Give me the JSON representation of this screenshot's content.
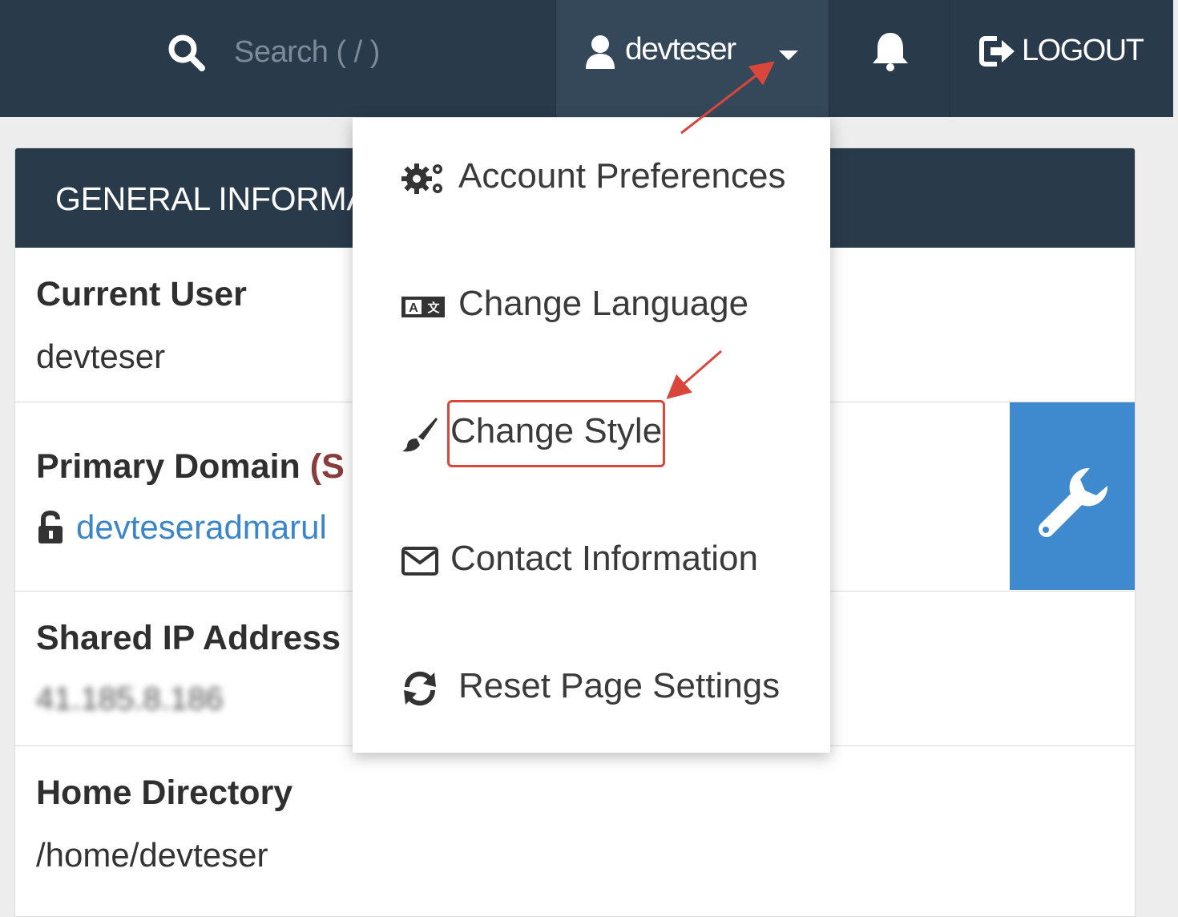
{
  "topbar": {
    "search_placeholder": "Search ( / )",
    "search_icon": "search-icon",
    "username": "devteser",
    "user_icon": "user-icon",
    "caret_icon": "caret-down-icon",
    "bell_icon": "bell-icon",
    "logout_label": "LOGOUT",
    "logout_icon": "sign-out-icon"
  },
  "panel": {
    "title": "GENERAL INFORMATION",
    "rows": [
      {
        "label": "Current User",
        "value": "devteser"
      },
      {
        "label": "Primary Domain",
        "label_suffix": "(S",
        "value": "devteseradmarul"
      },
      {
        "label": "Shared IP Address",
        "value": "41.185.8.186"
      },
      {
        "label": "Home Directory",
        "value": "/home/devteser"
      }
    ],
    "wrench_icon": "wrench-icon"
  },
  "dropdown": {
    "items": [
      {
        "label": "Account Preferences",
        "icon": "gears-icon"
      },
      {
        "label": "Change Language",
        "icon": "language-icon"
      },
      {
        "label": "Change Style",
        "icon": "paintbrush-icon",
        "highlighted": true
      },
      {
        "label": "Contact Information",
        "icon": "envelope-icon"
      },
      {
        "label": "Reset Page Settings",
        "icon": "refresh-icon"
      }
    ]
  },
  "colors": {
    "topbar_bg": "#293a4a",
    "user_menu_bg": "#35485a",
    "accent_blue": "#3f8ace",
    "link_blue": "#3a86c8",
    "annotation_red": "#d9473c"
  }
}
